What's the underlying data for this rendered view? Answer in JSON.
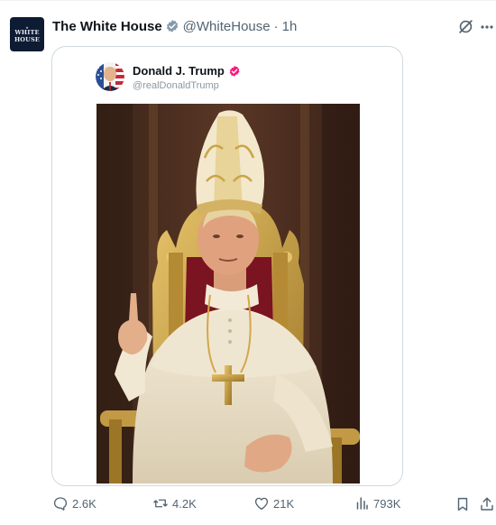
{
  "post": {
    "author_name": "The White House",
    "author_handle": "@WhiteHouse",
    "separator": "·",
    "time": "1h",
    "avatar_text": [
      "WHITE",
      "HOUSE"
    ]
  },
  "quoted_post": {
    "author_name": "Donald J. Trump",
    "author_handle": "@realDonaldTrump"
  },
  "actions": {
    "replies": "2.6K",
    "reposts": "4.2K",
    "likes": "21K",
    "views": "793K"
  },
  "colors": {
    "muted_text": "#536471",
    "border": "#cfd9de",
    "verified_gray": "#829aab",
    "verified_pink": "#f91880",
    "avatar_navy": "#0d1b33"
  },
  "icons": [
    "verified-badge-icon",
    "grok-icon",
    "more-icon",
    "reply-icon",
    "repost-icon",
    "like-icon",
    "views-icon",
    "bookmark-icon",
    "share-icon"
  ]
}
